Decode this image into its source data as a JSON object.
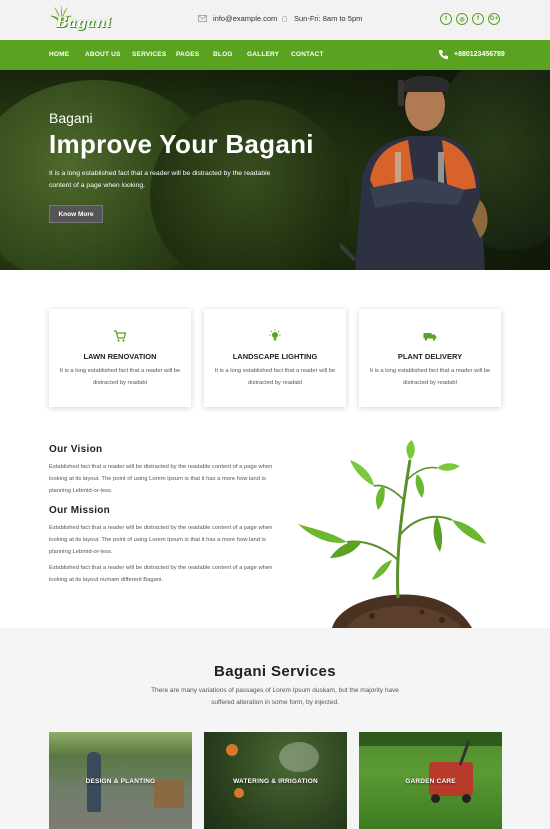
{
  "header": {
    "logo_text": "Bagani",
    "email": "info@example.com",
    "hours": "Sun-Fri: 8am to 5pm",
    "social_icons": [
      "twitter-icon",
      "instagram-icon",
      "facebook-icon",
      "google-plus-icon"
    ],
    "social_glyphs": [
      "t",
      "◎",
      "f",
      "G+"
    ]
  },
  "nav": {
    "items": [
      "HOME",
      "ABOUT US",
      "SERVICES",
      "PAGES",
      "BLOG",
      "GALLERY",
      "CONTACT"
    ],
    "phone": "+880123456789"
  },
  "hero": {
    "subtitle": "Bagani",
    "title": "Improve Your Bagani",
    "text": "It is a long established fact that a reader will be distracted by the readable content of a page when looking.",
    "button": "Know More"
  },
  "features": [
    {
      "icon": "cart-icon",
      "title": "LAWN RENOVATION",
      "text": "It is a long established fact that a reader will be distracted by readabl"
    },
    {
      "icon": "bulb-icon",
      "title": "LANDSCAPE LIGHTING",
      "text": "It is a long established fact that a reader will be distracted by readabl"
    },
    {
      "icon": "truck-icon",
      "title": "PLANT DELIVERY",
      "text": "It is a long established fact that a reader will be distracted by readabl"
    }
  ],
  "about": {
    "vision_title": "Our Vision",
    "vision_text": "Established fact that a reader will be distracted by the readable content of a page when looking at its layout. The point of using Lorem Ipsum is that it has a more how land is planning Lebmid-or-less.",
    "mission_title": "Our Mission",
    "mission_text_1": "Established fact that a reader will be distracted by the readable content of a page when looking at its layout. The point of using Lorem Ipsum is that it has a more how land is planning Lebmid-or-less.",
    "mission_text_2": "Established fact that a reader will be distracted by the readable content of a page when looking at its layout numam different Bagani."
  },
  "services": {
    "title": "Bagani Services",
    "text": "There are many variations of passages of Lorem Ipsum duskam, but the majority have suffered alteration in some form, by injected.",
    "items": [
      "DESIGN & PLANTING",
      "WATERING & IRRIGATION",
      "GARDEN CARE"
    ]
  },
  "colors": {
    "accent": "#5aa321",
    "topbar": "#f2f2f2",
    "services_bg": "#f5f5f5"
  }
}
